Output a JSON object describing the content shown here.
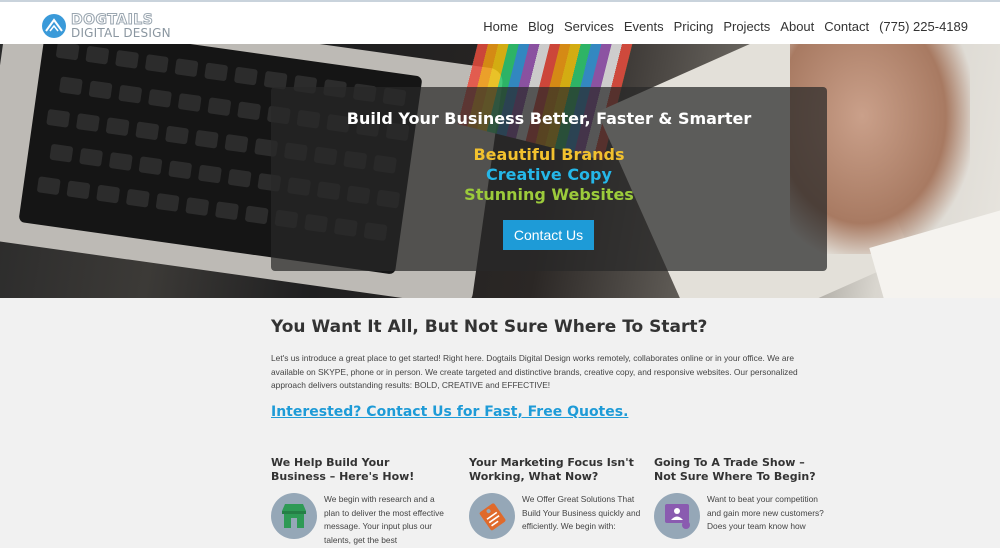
{
  "header": {
    "logo_top": "DOGTAILS",
    "logo_bottom": "DIGITAL DESIGN",
    "nav": [
      "Home",
      "Blog",
      "Services",
      "Events",
      "Pricing",
      "Projects",
      "About",
      "Contact",
      "(775) 225-4189"
    ]
  },
  "hero": {
    "title": "Build Your Business Better, Faster & Smarter",
    "lines": [
      {
        "text": "Beautiful Brands",
        "color": "#f2c12e"
      },
      {
        "text": "Creative Copy",
        "color": "#25b7e8"
      },
      {
        "text": "Stunning Websites",
        "color": "#9ccb3b"
      }
    ],
    "button": "Contact Us"
  },
  "main": {
    "title": "You Want It All, But Not Sure Where To Start?",
    "intro": "Let's us introduce a great place to get started!  Right here.  Dogtails Digital Design works remotely, collaborates online or in your office.  We are available on SKYPE, phone or in person. We create targeted and distinctive brands, creative copy, and responsive websites. Our personalized approach delivers outstanding results: BOLD, CREATIVE and EFFECTIVE!",
    "cta": "Interested? Contact Us for Fast, Free Quotes.",
    "features": [
      {
        "title": "We Help Build Your Business – Here's How!",
        "icon": "storefront-icon",
        "text": "We begin with research and a plan to deliver the most effective message. Your input plus our talents, get the best"
      },
      {
        "title": "Your Marketing Focus Isn't Working, What Now?",
        "icon": "price-tag-icon",
        "text": "We Offer Great Solutions That Build Your Business quickly and efficiently. We begin with:"
      },
      {
        "title": "Going To A Trade Show – Not Sure Where To Begin?",
        "icon": "presentation-icon",
        "text": "Want to beat your competition and gain more new customers? Does your team know how"
      }
    ]
  },
  "colors": {
    "accent": "#1e9bd7",
    "icon_circle": "#95a7b7",
    "icon_green": "#2e9a55",
    "icon_orange": "#e06a2b",
    "icon_purple": "#8a5bb0"
  }
}
